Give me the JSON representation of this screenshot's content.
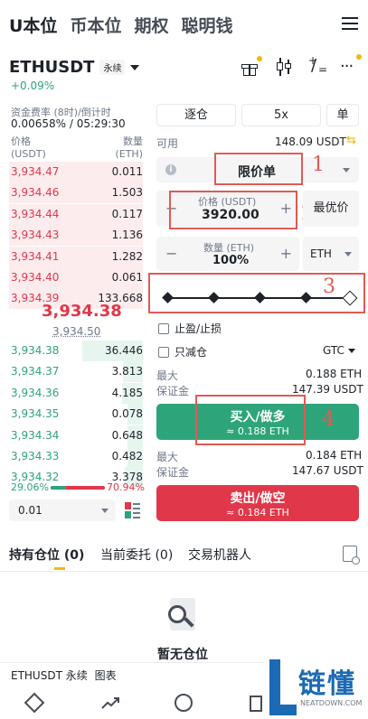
{
  "top_tabs": [
    "U本位",
    "币本位",
    "期权",
    "聪明钱"
  ],
  "symbol": {
    "name": "ETHUSDT",
    "type": "永续",
    "change": "+0.09%"
  },
  "funding": {
    "label": "资金费率 (8时)/倒计时",
    "value": "0.00658% / 05:29:30"
  },
  "orderbook": {
    "price_header": "价格",
    "price_unit": "(USDT)",
    "qty_header": "数量",
    "qty_unit": "(ETH)",
    "asks": [
      {
        "price": "3,934.47",
        "qty": "0.011"
      },
      {
        "price": "3,934.46",
        "qty": "1.503"
      },
      {
        "price": "3,934.44",
        "qty": "0.117"
      },
      {
        "price": "3,934.43",
        "qty": "1.136"
      },
      {
        "price": "3,934.41",
        "qty": "1.282"
      },
      {
        "price": "3,934.40",
        "qty": "0.061"
      },
      {
        "price": "3,934.39",
        "qty": "133.668"
      }
    ],
    "last_price": "3,934.38",
    "mark_price": "3,934.50",
    "bids": [
      {
        "price": "3,934.38",
        "qty": "36.446"
      },
      {
        "price": "3,934.37",
        "qty": "3.813"
      },
      {
        "price": "3,934.36",
        "qty": "4.185"
      },
      {
        "price": "3,934.35",
        "qty": "0.078"
      },
      {
        "price": "3,934.34",
        "qty": "0.648"
      },
      {
        "price": "3,934.33",
        "qty": "0.482"
      },
      {
        "price": "3,934.32",
        "qty": "3.378"
      }
    ],
    "buy_ratio": "29.06%",
    "sell_ratio": "70.94%",
    "buy_ratio_value": 29.06,
    "precision": "0.01"
  },
  "order_form": {
    "margin_mode": "逐仓",
    "leverage": "5x",
    "position_mode": "单",
    "available_label": "可用",
    "available_value": "148.09 USDT",
    "order_type": "限价单",
    "price_label": "价格 (USDT)",
    "price_value": "3920.00",
    "best_price": "最优价",
    "qty_label": "数量 (ETH)",
    "qty_value": "100%",
    "qty_unit": "ETH",
    "slider_fraction": 1.0,
    "tp_sl": "止盈/止损",
    "reduce_only": "只减仓",
    "tif": "GTC",
    "max_label": "最大",
    "margin_label": "保证金",
    "buy_max": "0.188 ETH",
    "buy_margin": "147.39 USDT",
    "buy_label": "买入/做多",
    "buy_sub": "≈ 0.188 ETH",
    "sell_max": "0.184 ETH",
    "sell_margin": "147.67 USDT",
    "sell_label": "卖出/做空",
    "sell_sub": "≈ 0.184 ETH"
  },
  "annotations": [
    "1",
    "2",
    "3",
    "4"
  ],
  "bottom_tabs": {
    "positions": "持有仓位",
    "positions_count": "(0)",
    "orders": "当前委托",
    "orders_count": "(0)",
    "bots": "交易机器人"
  },
  "empty_state": "暂无仓位",
  "footer": {
    "symbol": "ETHUSDT 永续",
    "chart": "图表"
  },
  "watermark": {
    "cn": "链懂",
    "en": "NEATDOWN.COM"
  }
}
